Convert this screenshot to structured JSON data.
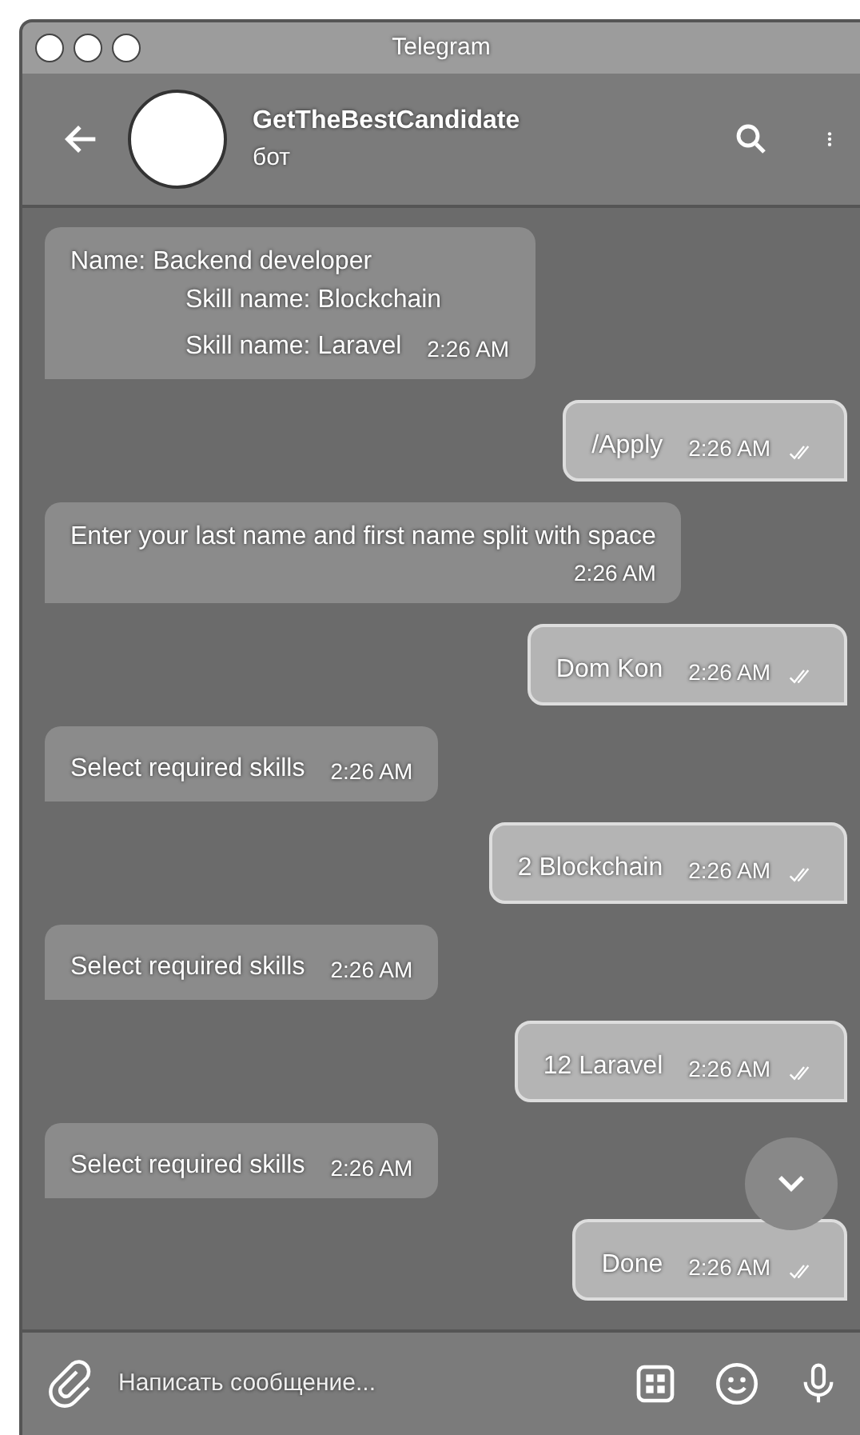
{
  "window": {
    "title": "Telegram"
  },
  "chat": {
    "name": "GetTheBestCandidate",
    "status": "бот"
  },
  "messages": [
    {
      "kind": "in",
      "lines": [
        "Name: Backend developer",
        "Skill name: Blockchain",
        "Skill name: Laravel"
      ],
      "time": "2:26 AM"
    },
    {
      "kind": "out",
      "lines": [
        "/Apply"
      ],
      "time": "2:26 AM",
      "read": true
    },
    {
      "kind": "in",
      "lines": [
        "Enter your last name and first name split with space"
      ],
      "time": "2:26 AM"
    },
    {
      "kind": "out",
      "lines": [
        "Dom Kon"
      ],
      "time": "2:26 AM",
      "read": true
    },
    {
      "kind": "in",
      "lines": [
        "Select required skills"
      ],
      "time": "2:26 AM"
    },
    {
      "kind": "out",
      "lines": [
        "2 Blockchain"
      ],
      "time": "2:26 AM",
      "read": true
    },
    {
      "kind": "in",
      "lines": [
        "Select required skills"
      ],
      "time": "2:26 AM"
    },
    {
      "kind": "out",
      "lines": [
        "12 Laravel"
      ],
      "time": "2:26 AM",
      "read": true
    },
    {
      "kind": "in",
      "lines": [
        "Select required skills"
      ],
      "time": "2:26 AM"
    },
    {
      "kind": "out",
      "lines": [
        "Done"
      ],
      "time": "2:26 AM",
      "read": true
    }
  ],
  "composer": {
    "placeholder": "Написать сообщение..."
  }
}
